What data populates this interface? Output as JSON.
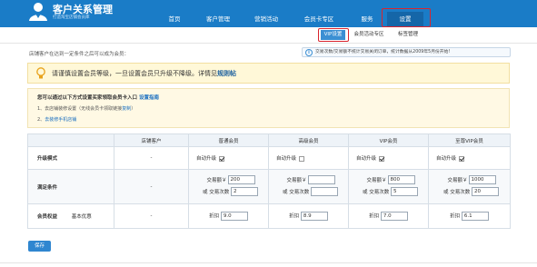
{
  "app": {
    "title": "客户关系管理",
    "subtitle": "打造淘宝店铺会员库"
  },
  "nav": {
    "items": [
      "首页",
      "客户管理",
      "营销活动",
      "会员卡专区",
      "服务",
      "设置"
    ],
    "active": "设置"
  },
  "subnav": {
    "items": [
      "VIP设置",
      "会员活动专区",
      "标签管理"
    ],
    "active": "VIP设置"
  },
  "intro": "店铺客户在达到一定条件之后可以成为会员：",
  "info": "交易次数/交易额不统计交易关闭订单，统计数据从2009年5月份开始!",
  "warning": {
    "text": "请谨慎设置会员等级，一旦设置会员只升级不降级。详情见",
    "link": "规则帖"
  },
  "guide": {
    "title": "您可以通过以下方式设置买家领取会员卡入口",
    "title_link": "设置指南",
    "step1_prefix": "1、去店铺装修设置（无线会员卡领取链接",
    "step1_link": "复制",
    "step1_suffix": "）",
    "step1_link_text": "去店铺装修设置",
    "step2_prefix": "2、",
    "step2_link": "去装修手机店铺"
  },
  "table": {
    "headers": [
      "",
      "店铺客户",
      "普通会员",
      "高级会员",
      "VIP会员",
      "至尊VIP会员"
    ],
    "rows": {
      "upgrade": {
        "label": "升级模式",
        "shop": "-",
        "auto_label": "自动升级",
        "checked": [
          true,
          false,
          true,
          true
        ]
      },
      "conditions": {
        "label": "满足条件",
        "shop": "-",
        "amount_label": "交易额￥",
        "or_label": "或",
        "count_label": "交易次数",
        "amounts": [
          "200",
          "",
          "800",
          "1000"
        ],
        "counts": [
          "2",
          "",
          "5",
          "20"
        ]
      },
      "benefits": {
        "label": "会员权益",
        "sublabel": "基本优惠",
        "shop": "-",
        "discount_label": "折扣",
        "discounts": [
          "9.0",
          "8.9",
          "7.0",
          "6.1"
        ]
      }
    }
  },
  "save_button": "保存",
  "colors": {
    "header": "#1a7cc7",
    "highlight": "#d9252e",
    "accent": "#2f86d0"
  }
}
